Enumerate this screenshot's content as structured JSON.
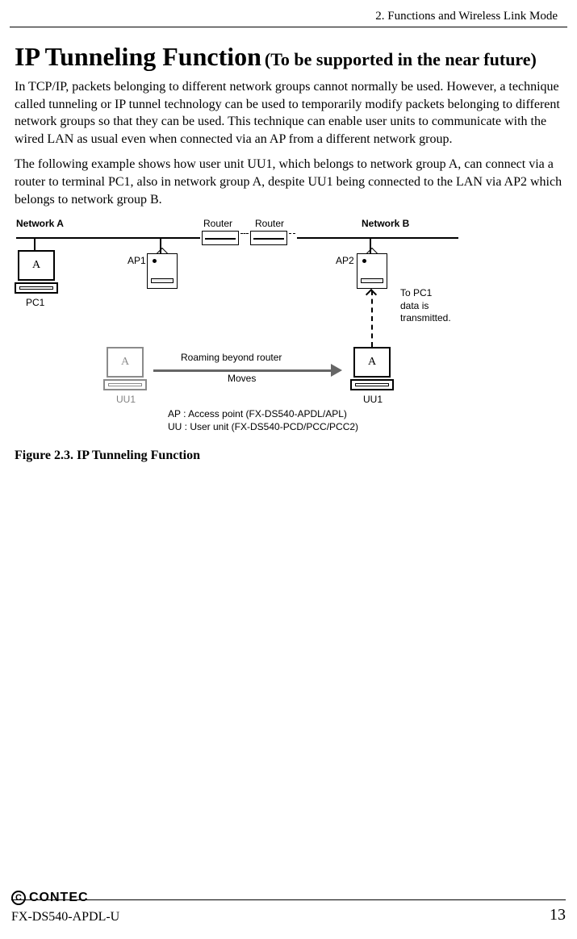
{
  "header": {
    "section_title": "2. Functions and Wireless Link Mode"
  },
  "title": {
    "main": "IP Tunneling Function",
    "sub": "(To be supported in the near future)"
  },
  "paragraphs": {
    "p1": "In TCP/IP, packets belonging to different network groups cannot normally be used.  However, a technique called tunneling or IP tunnel technology can be used to temporarily modify packets belonging to different network groups so that they can be used.  This technique can enable user units to communicate with the wired LAN as usual even when connected via an AP from a different network group.",
    "p2": "The following example shows how user unit UU1, which belongs to network group A, can connect via a router to terminal PC1, also in network group A, despite UU1 being connected to the LAN via AP2 which belongs to network group B."
  },
  "figure": {
    "network_a": "Network A",
    "network_b": "Network B",
    "router1": "Router",
    "router2": "Router",
    "ap1": "AP1",
    "ap2": "AP2",
    "pc1_letter": "A",
    "pc1_label": "PC1",
    "uu1_gray_letter": "A",
    "uu1_gray_label": "UU1",
    "uu1_letter": "A",
    "uu1_label": "UU1",
    "roaming_line1": "Roaming beyond router",
    "roaming_line2": "Moves",
    "note_line1": "To PC1",
    "note_line2": "data is",
    "note_line3": "transmitted.",
    "legend_line1": "AP  : Access point (FX-DS540-APDL/APL)",
    "legend_line2": "UU : User unit (FX-DS540-PCD/PCC/PCC2)",
    "caption": "Figure 2.3.  IP Tunneling Function"
  },
  "footer": {
    "brand_mark": "C",
    "brand": "CONTEC",
    "model": "FX-DS540-APDL-U",
    "page": "13"
  }
}
